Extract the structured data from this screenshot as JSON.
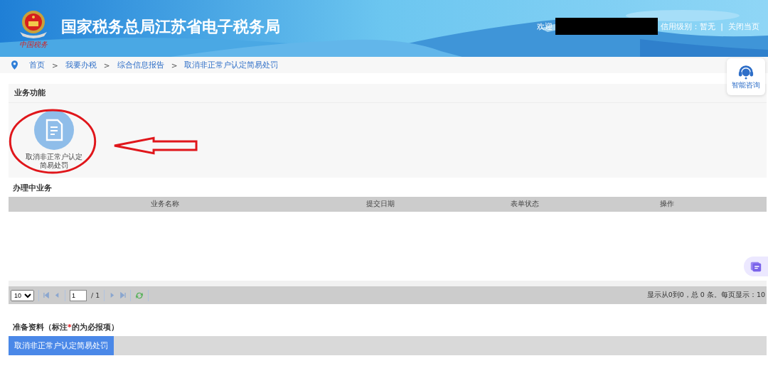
{
  "header": {
    "logo_caption": "中国税务",
    "title": "国家税务总局江苏省电子税务局",
    "welcome": "欢迎",
    "credit": "信用级别：暂无",
    "separator": "|",
    "close": "关闭当页"
  },
  "breadcrumb": {
    "separator": ">",
    "items": [
      {
        "label": "首页"
      },
      {
        "label": "我要办税"
      },
      {
        "label": "综合信息报告"
      },
      {
        "label": "取消非正常户认定简易处罚"
      }
    ]
  },
  "consult": {
    "label": "智能咨询"
  },
  "functions": {
    "title": "业务功能",
    "items": [
      {
        "label": "取消非正常户认定简易处罚"
      }
    ]
  },
  "in_progress": {
    "title": "办理中业务",
    "columns": [
      "业务名称",
      "提交日期",
      "表单状态",
      "操作"
    ]
  },
  "pager": {
    "page_size": "10",
    "page": "1",
    "total_pages": "/ 1",
    "summary": "显示从0到0，总 0 条。每页显示：10"
  },
  "materials": {
    "title_before": "准备资料（标注",
    "required_mark": "*",
    "title_after": "的为必报项）",
    "tabs": [
      {
        "label": "取消非正常户认定简易处罚",
        "selected": true
      }
    ]
  }
}
